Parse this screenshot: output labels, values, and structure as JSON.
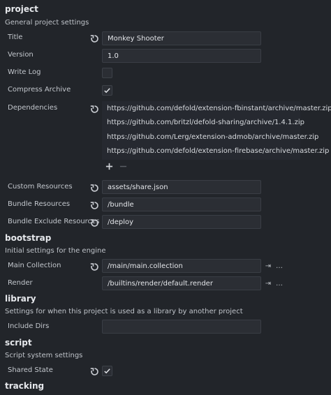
{
  "project": {
    "title": "project",
    "description": "General project settings",
    "title_label": "Title",
    "title_value": "Monkey Shooter",
    "version_label": "Version",
    "version_value": "1.0",
    "write_log_label": "Write Log",
    "write_log_checked": false,
    "compress_archive_label": "Compress Archive",
    "compress_archive_checked": true,
    "dependencies_label": "Dependencies",
    "dependencies": [
      "https://github.com/defold/extension-fbinstant/archive/master.zip",
      "https://github.com/britzl/defold-sharing/archive/1.4.1.zip",
      "https://github.com/Lerg/extension-admob/archive/master.zip",
      "https://github.com/defold/extension-firebase/archive/master.zip"
    ],
    "add_icon": "plus-icon",
    "remove_icon": "minus-icon",
    "custom_resources_label": "Custom Resources",
    "custom_resources_value": "assets/share.json",
    "bundle_resources_label": "Bundle Resources",
    "bundle_resources_value": "/bundle",
    "bundle_exclude_label": "Bundle Exclude Resources",
    "bundle_exclude_value": "/deploy"
  },
  "bootstrap": {
    "title": "bootstrap",
    "description": "Initial settings for the engine",
    "main_collection_label": "Main Collection",
    "main_collection_value": "/main/main.collection",
    "render_label": "Render",
    "render_value": "/builtins/render/default.render",
    "goto_glyph": "⇥",
    "browse_glyph": "…"
  },
  "library": {
    "title": "library",
    "description": "Settings for when this project is used as a library by another project",
    "include_dirs_label": "Include Dirs",
    "include_dirs_value": ""
  },
  "script": {
    "title": "script",
    "description": "Script system settings",
    "shared_state_label": "Shared State",
    "shared_state_checked": true
  },
  "tracking": {
    "title": "tracking"
  },
  "colors": {
    "background": "#22252a",
    "field_bg": "#2b2e34",
    "text": "#c9ccd2"
  }
}
